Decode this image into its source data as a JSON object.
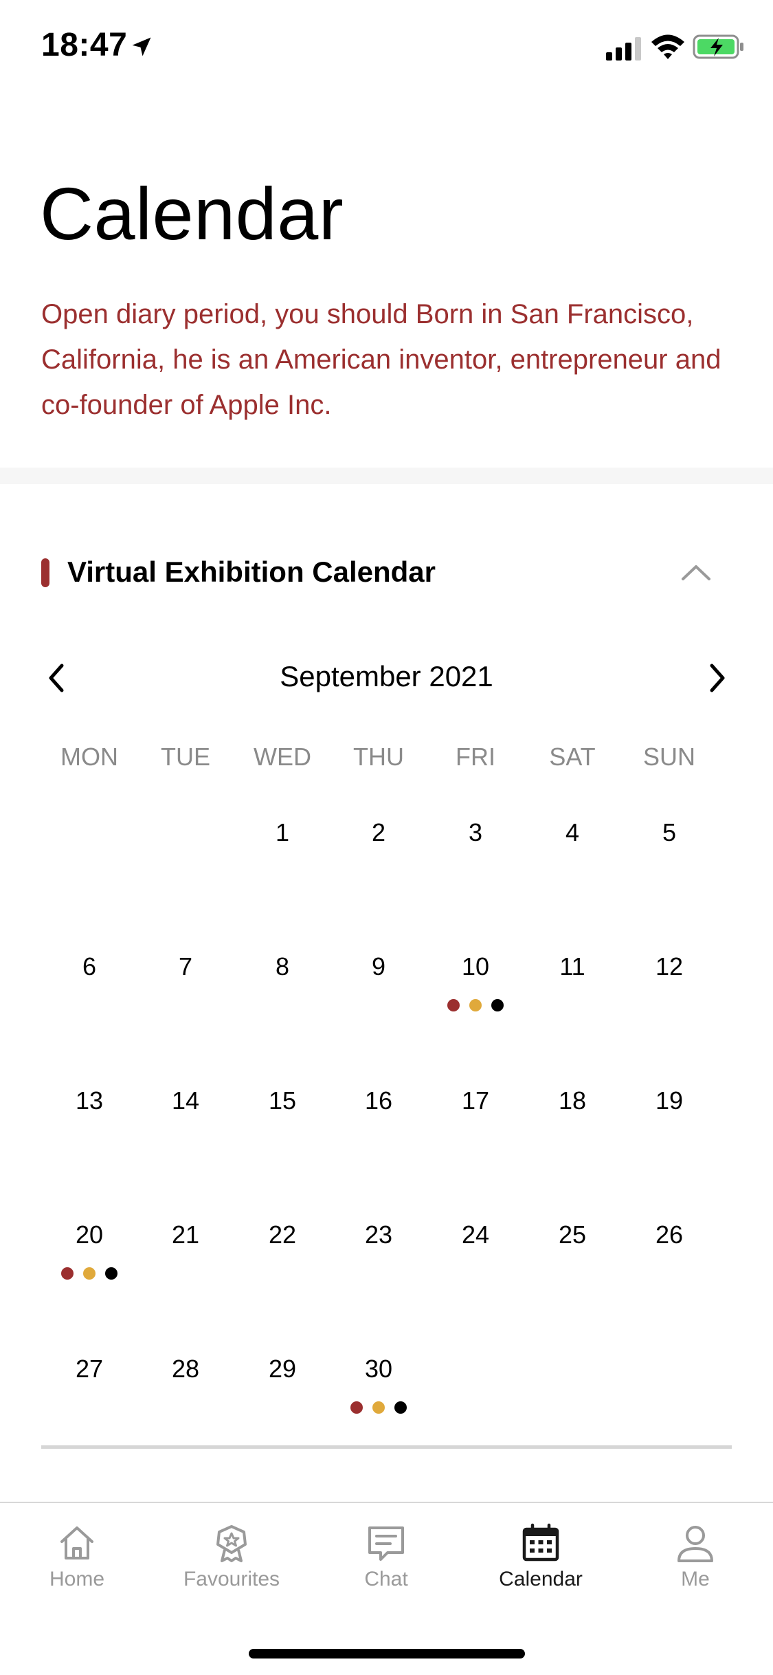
{
  "status_bar": {
    "time": "18:47"
  },
  "header": {
    "title": "Calendar",
    "description": "Open diary period, you should Born in San Francisco, California, he is an American inventor, entrepreneur and co-founder of Apple Inc."
  },
  "section": {
    "title": "Virtual Exhibition Calendar"
  },
  "calendar": {
    "month_label": "September 2021",
    "weekdays": [
      "MON",
      "TUE",
      "WED",
      "THU",
      "FRI",
      "SAT",
      "SUN"
    ],
    "weeks": [
      [
        "",
        "",
        "1",
        "2",
        "3",
        "4",
        "5"
      ],
      [
        "6",
        "7",
        "8",
        "9",
        "10",
        "11",
        "12"
      ],
      [
        "13",
        "14",
        "15",
        "16",
        "17",
        "18",
        "19"
      ],
      [
        "20",
        "21",
        "22",
        "23",
        "24",
        "25",
        "26"
      ],
      [
        "27",
        "28",
        "29",
        "30",
        "",
        "",
        ""
      ]
    ],
    "event_days": [
      "10",
      "20",
      "30"
    ],
    "event_dot_colors": [
      "#9b2f2f",
      "#e0a93b",
      "#000000"
    ]
  },
  "tab_bar": {
    "tabs": [
      {
        "label": "Home",
        "icon": "home-icon",
        "active": false
      },
      {
        "label": "Favourites",
        "icon": "favourites-icon",
        "active": false
      },
      {
        "label": "Chat",
        "icon": "chat-icon",
        "active": false
      },
      {
        "label": "Calendar",
        "icon": "calendar-icon",
        "active": true
      },
      {
        "label": "Me",
        "icon": "person-icon",
        "active": false
      }
    ]
  },
  "colors": {
    "accent": "#9b2f2f",
    "gold": "#e0a93b",
    "battery_green": "#4cd964"
  }
}
